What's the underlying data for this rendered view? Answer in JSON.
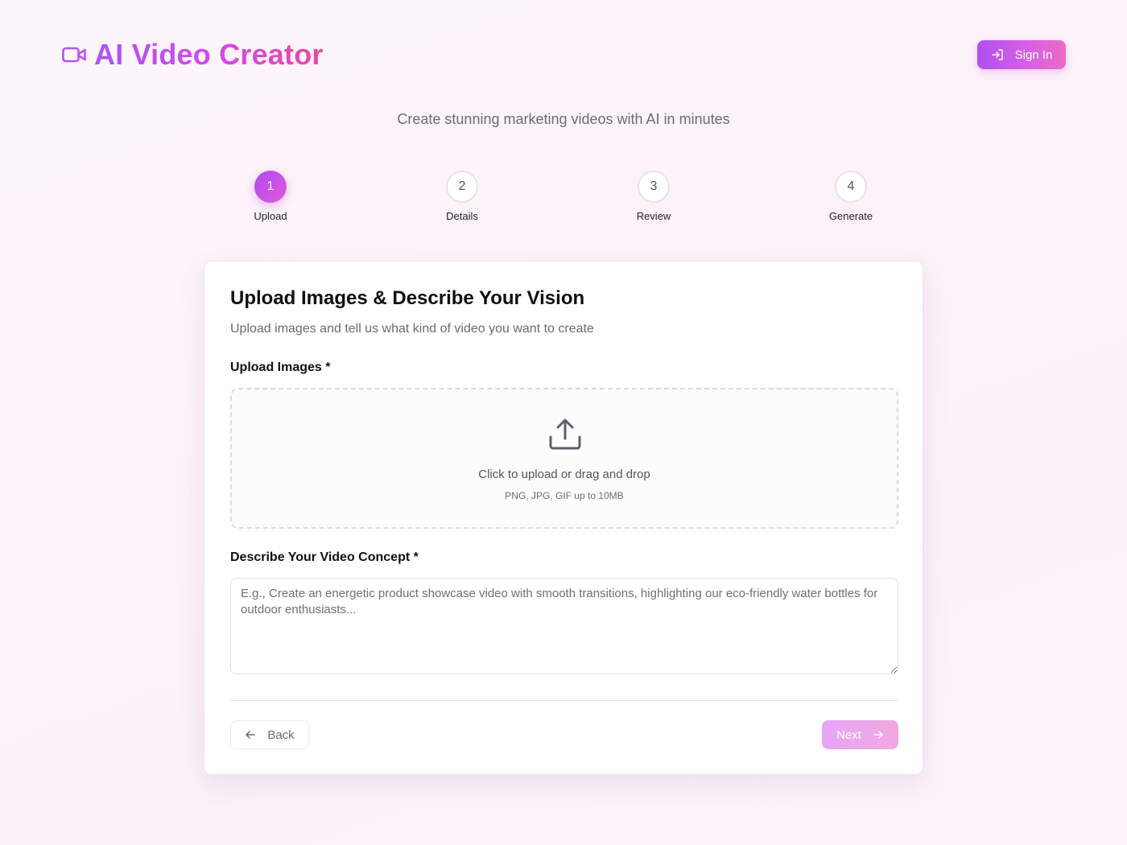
{
  "header": {
    "app_title": "AI Video Creator",
    "logo_icon": "video-camera-icon",
    "sign_in_label": "Sign In",
    "sign_in_icon": "log-in-icon",
    "brand_gradient": [
      "#a855f7",
      "#d946ef",
      "#ec4899"
    ]
  },
  "tagline": "Create stunning marketing videos with AI in minutes",
  "steps": [
    {
      "number": "1",
      "label": "Upload",
      "active": true
    },
    {
      "number": "2",
      "label": "Details",
      "active": false
    },
    {
      "number": "3",
      "label": "Review",
      "active": false
    },
    {
      "number": "4",
      "label": "Generate",
      "active": false
    }
  ],
  "card": {
    "title": "Upload Images & Describe Your Vision",
    "subtitle": "Upload images and tell us what kind of video you want to create",
    "upload_label": "Upload Images *",
    "dropzone": {
      "icon": "upload-icon",
      "main_text": "Click to upload or drag and drop",
      "hint_text": "PNG, JPG, GIF up to 10MB"
    },
    "concept_label": "Describe Your Video Concept *",
    "concept_value": "",
    "concept_placeholder": "E.g., Create an energetic product showcase video with smooth transitions, highlighting our eco-friendly water bottles for outdoor enthusiasts...",
    "back_label": "Back",
    "back_icon": "arrow-left-icon",
    "next_label": "Next",
    "next_icon": "arrow-right-icon",
    "next_disabled": true
  }
}
